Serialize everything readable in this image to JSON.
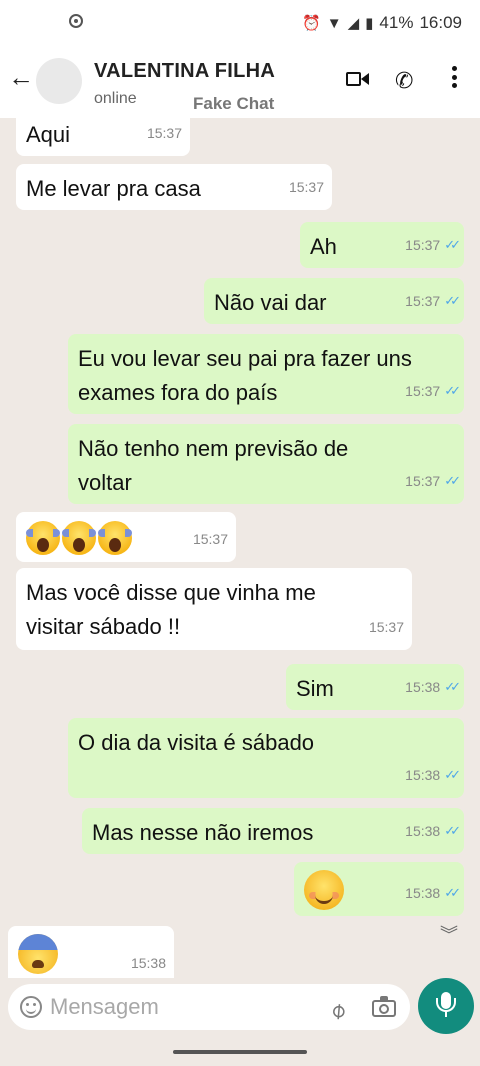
{
  "status_bar": {
    "battery": "41%",
    "time": "16:09"
  },
  "header": {
    "contact_name": "VALENTINA FILHA",
    "status": "online",
    "watermark": "Fake Chat"
  },
  "messages": [
    {
      "dir": "in",
      "text": "Aqui",
      "time": "15:37"
    },
    {
      "dir": "in",
      "text": "Me levar pra casa",
      "time": "15:37"
    },
    {
      "dir": "out",
      "text": "Ah",
      "time": "15:37",
      "read": true
    },
    {
      "dir": "out",
      "text": "Não vai dar",
      "time": "15:37",
      "read": true
    },
    {
      "dir": "out",
      "text": "Eu vou levar seu pai pra fazer uns\nexames fora do país",
      "time": "15:37",
      "read": true
    },
    {
      "dir": "out",
      "text": "Não tenho nem previsão de\nvoltar",
      "time": "15:37",
      "read": true
    },
    {
      "dir": "in",
      "emoji": "screaming-face x3",
      "time": "15:37"
    },
    {
      "dir": "in",
      "text": "Mas você disse que vinha me\nvisitar sábado !!",
      "time": "15:37"
    },
    {
      "dir": "out",
      "text": "Sim",
      "time": "15:38",
      "read": true
    },
    {
      "dir": "out",
      "text": "O dia da visita é sábado",
      "time": "15:38",
      "read": true
    },
    {
      "dir": "out",
      "text": "Mas nesse não iremos",
      "time": "15:38",
      "read": true
    },
    {
      "dir": "out",
      "emoji": "smiling-face",
      "time": "15:38",
      "read": true
    },
    {
      "dir": "in",
      "emoji": "fearful-face",
      "time": "15:38"
    }
  ],
  "composer": {
    "placeholder": "Mensagem"
  },
  "icons": {
    "header": [
      "back-arrow-icon",
      "video-call-icon",
      "phone-icon",
      "menu-icon"
    ],
    "composer": [
      "emoji-icon",
      "attach-icon",
      "camera-icon",
      "mic-icon"
    ]
  },
  "colors": {
    "incoming_bubble": "#ffffff",
    "outgoing_bubble": "#dcf8c6",
    "chat_background": "#efe9e4",
    "read_ticks": "#4fa6e8",
    "mic_button": "#128c7e"
  }
}
